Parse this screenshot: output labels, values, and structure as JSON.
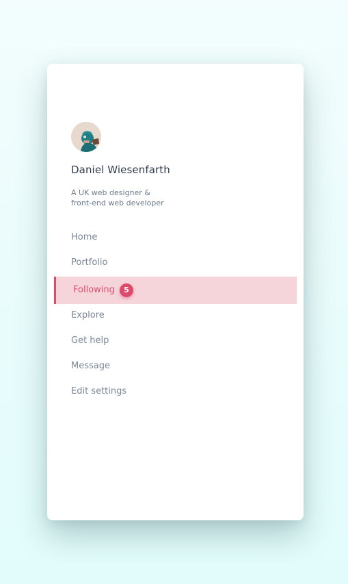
{
  "profile": {
    "name": "Daniel Wiesenfarth",
    "bio_line1": "A UK web designer &",
    "bio_line2": "front-end web developer"
  },
  "nav": {
    "items": [
      {
        "label": "Home"
      },
      {
        "label": "Portfolio"
      },
      {
        "label": "Following",
        "badge": "5",
        "active": true
      },
      {
        "label": "Explore"
      },
      {
        "label": "Get help"
      },
      {
        "label": "Message"
      },
      {
        "label": "Edit settings"
      }
    ]
  },
  "colors": {
    "accent": "#dc4a6c",
    "active_bg": "#f5d5da",
    "text_muted": "#7a8798",
    "text_dark": "#2f3b4d"
  }
}
